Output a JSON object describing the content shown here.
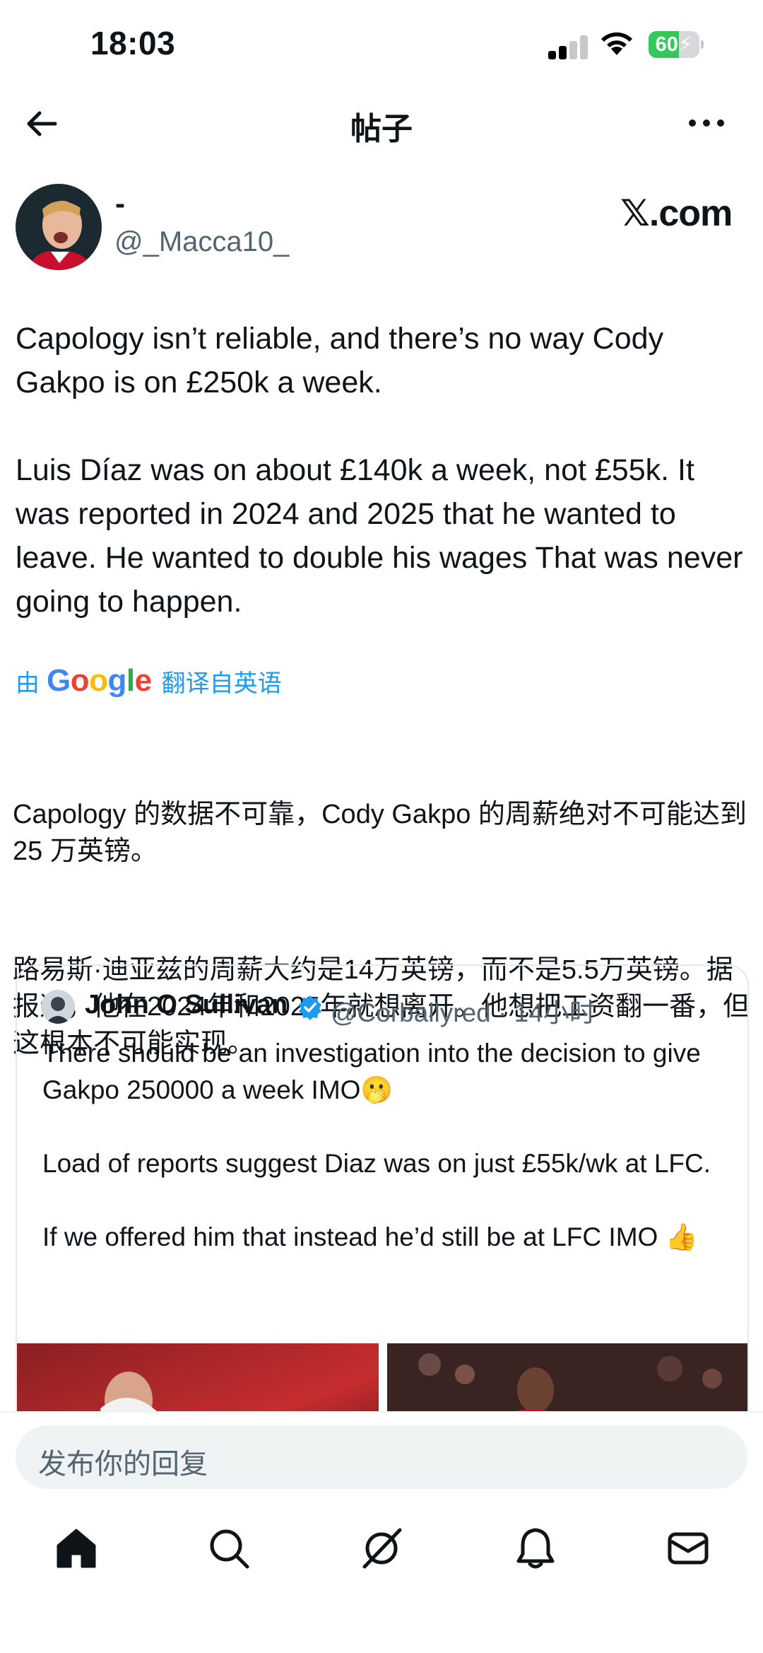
{
  "status_bar": {
    "time": "18:03",
    "battery": "60",
    "battery_level": 0.6
  },
  "nav": {
    "title": "帖子"
  },
  "author": {
    "name": "-",
    "handle": "@_Macca10_",
    "source": "𝕏.com"
  },
  "tweet": {
    "text": "Capology isn’t reliable, and there’s no way Cody Gakpo is on £250k a week.\n\nLuis Díaz was on about £140k a week, not £55k. It was reported in 2024 and 2025 that he wanted to leave. He wanted to double his wages That was never going to happen."
  },
  "translation": {
    "prefix": "由",
    "provider": "Google",
    "suffix": "翻译自英语",
    "para1": "Capology 的数据不可靠，Cody Gakpo 的周薪绝对不可能达到 25 万英镑。",
    "para2": "路易斯·迪亚兹的周薪大约是14万英镑，而不是5.5万英镑。据报道，他在2024年和2025年就想离开。他想把工资翻一番，但这根本不可能实现。"
  },
  "quote": {
    "name": "John O Sullivan",
    "handle": "@Corballyred · 14小时",
    "text": "There should be an investigation into the decision to give Gakpo 250000 a week IMO🫢\n\nLoad of reports suggest Diaz was on just £55k/wk at LFC.\n\nIf we offered him that instead he’d still be at LFC IMO 👍"
  },
  "reply": {
    "placeholder": "发布你的回复"
  },
  "tabs": [
    "home-icon",
    "search-icon",
    "grok-icon",
    "notifications-icon",
    "messages-icon"
  ],
  "colors": {
    "accent": "#1d9bf0",
    "verified": "#1d9bf0",
    "battery": "#34c759"
  }
}
